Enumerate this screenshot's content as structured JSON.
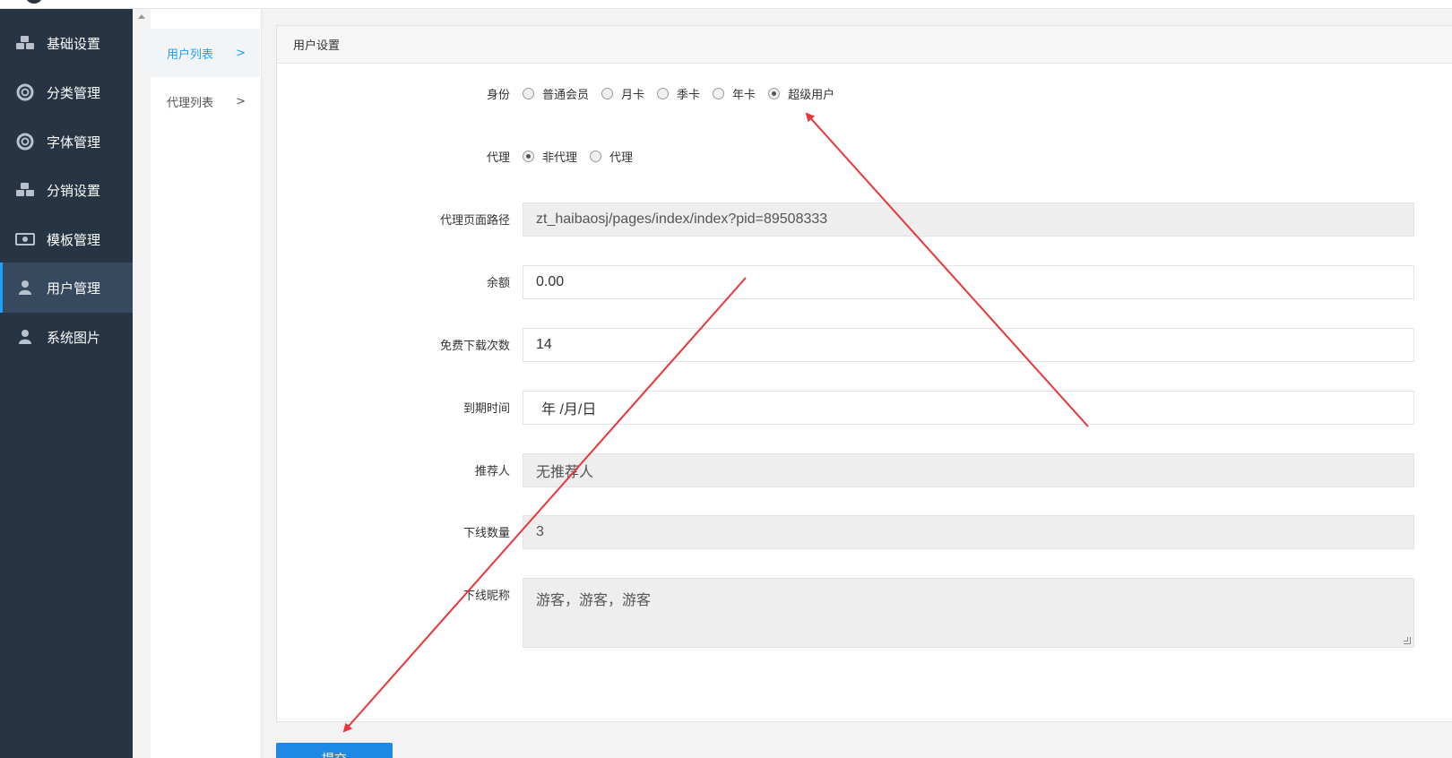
{
  "sidebar": {
    "items": [
      {
        "label": "基础设置",
        "icon": "cubes-icon"
      },
      {
        "label": "分类管理",
        "icon": "life-ring-icon"
      },
      {
        "label": "字体管理",
        "icon": "life-ring-icon"
      },
      {
        "label": "分销设置",
        "icon": "cubes-icon"
      },
      {
        "label": "模板管理",
        "icon": "money-icon"
      },
      {
        "label": "用户管理",
        "icon": "user-icon",
        "active": true
      },
      {
        "label": "系统图片",
        "icon": "user-icon"
      }
    ]
  },
  "subnav": {
    "items": [
      {
        "label": "用户列表",
        "active": true
      },
      {
        "label": "代理列表"
      }
    ],
    "chevron": ">"
  },
  "panel": {
    "title": "用户设置",
    "identity": {
      "label": "身份",
      "options": [
        "普通会员",
        "月卡",
        "季卡",
        "年卡",
        "超级用户"
      ],
      "selected": "超级用户"
    },
    "agent": {
      "label": "代理",
      "options": [
        "非代理",
        "代理"
      ],
      "selected": "非代理"
    },
    "agent_path": {
      "label": "代理页面路径",
      "value": "zt_haibaosj/pages/index/index?pid=89508333"
    },
    "balance": {
      "label": "余额",
      "value": "0.00"
    },
    "free_downloads": {
      "label": "免费下载次数",
      "value": "14"
    },
    "expiry": {
      "label": "到期时间",
      "placeholder": "年 /月/日"
    },
    "referrer": {
      "label": "推荐人",
      "value": "无推荐人"
    },
    "downline_count": {
      "label": "下线数量",
      "value": "3"
    },
    "downline_names": {
      "label": "下线昵称",
      "value": "游客，游客，游客"
    }
  },
  "submit_label": "提交",
  "colors": {
    "sidebar_bg": "#263444",
    "accent": "#1e9fff",
    "submit": "#1e88e5",
    "annotation_arrow": "#e8363a"
  }
}
